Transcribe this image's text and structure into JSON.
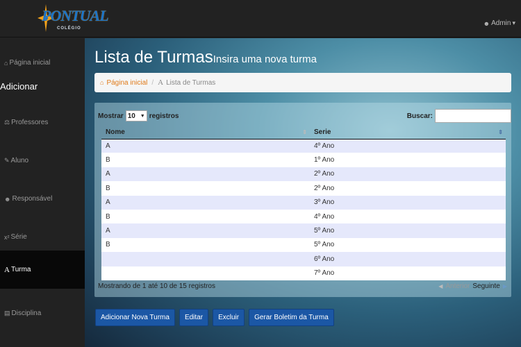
{
  "brand": {
    "logo_text": "PONTUAL",
    "logo_sub": "COLÉGIO"
  },
  "user": {
    "name": "Admin"
  },
  "sidebar": {
    "home": "Página inicial",
    "section": "Adicionar",
    "items": [
      {
        "label": "Professores",
        "icon": "flask-icon"
      },
      {
        "label": "Aluno",
        "icon": "pencil-icon"
      },
      {
        "label": "Responsável",
        "icon": "user-icon"
      },
      {
        "label": "Série",
        "icon": "superscript-icon"
      },
      {
        "label": "Turma",
        "icon": "font-icon",
        "active": true
      },
      {
        "label": "Disciplina",
        "icon": "book-icon"
      }
    ]
  },
  "page": {
    "title": "Lista de Turmas",
    "subtitle": "Insira uma nova turma"
  },
  "breadcrumb": {
    "home": "Página inicial",
    "separator": "/",
    "current": "Lista de Turmas"
  },
  "table_ctl": {
    "show_label": "Mostrar",
    "length_value": "10",
    "records_label": "registros",
    "search_label": "Buscar:"
  },
  "table": {
    "headers": [
      "Nome",
      "Serie"
    ],
    "rows": [
      [
        "A",
        "4º Ano"
      ],
      [
        "B",
        "1º Ano"
      ],
      [
        "A",
        "2º Ano"
      ],
      [
        "B",
        "2º Ano"
      ],
      [
        "A",
        "3º Ano"
      ],
      [
        "B",
        "4º Ano"
      ],
      [
        "A",
        "5º Ano"
      ],
      [
        "B",
        "5º Ano"
      ],
      [
        "",
        "6º Ano"
      ],
      [
        "",
        "7º Ano"
      ]
    ]
  },
  "footer": {
    "info": "Mostrando de 1 até 10 de 15 registros",
    "prev": "Anterior",
    "next": "Seguinte"
  },
  "buttons": {
    "add": "Adicionar Nova Turma",
    "edit": "Editar",
    "delete": "Excluir",
    "report": "Gerar Boletim da Turma"
  },
  "colors": {
    "primary_button": "#1b57a5",
    "breadcrumb_link": "#e07b1a",
    "row_stripe": "#e5e8fb"
  }
}
